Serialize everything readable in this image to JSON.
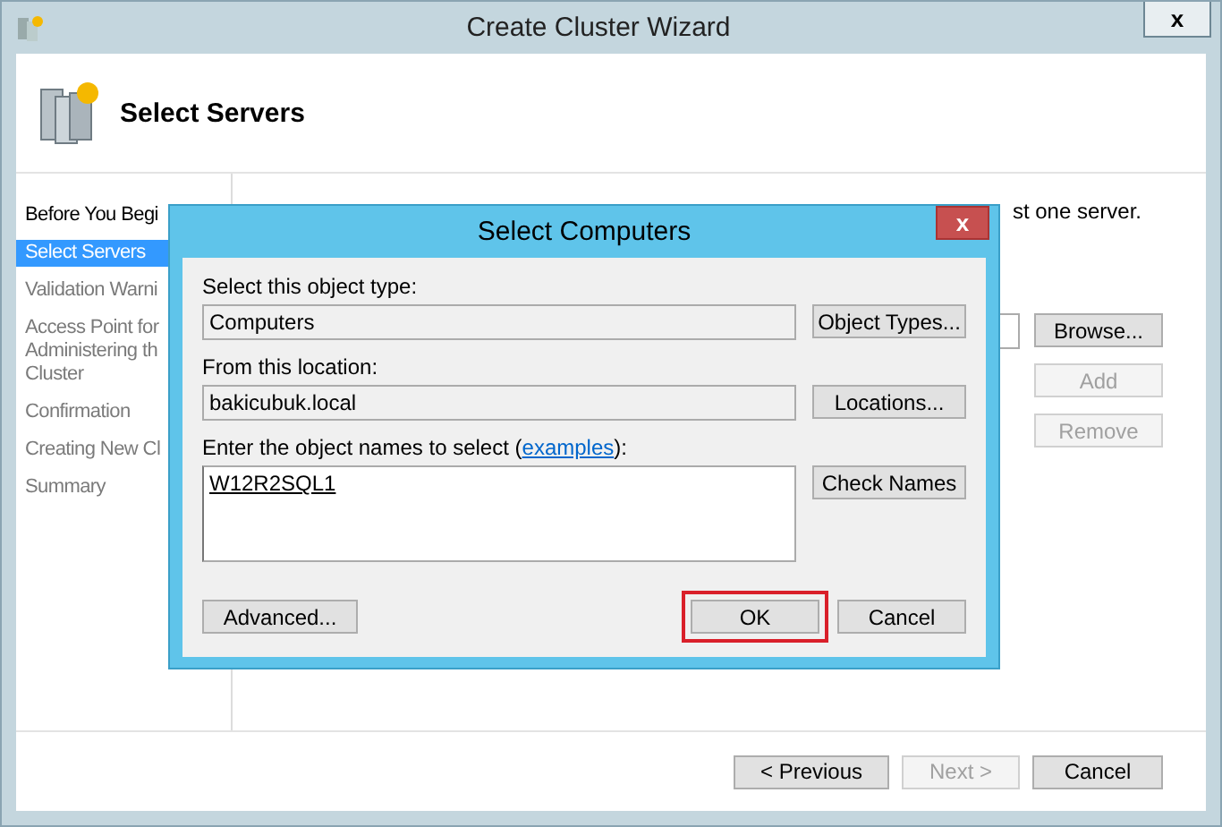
{
  "window": {
    "title": "Create Cluster Wizard",
    "close": "x"
  },
  "header": {
    "title": "Select Servers"
  },
  "steps": [
    {
      "lines": [
        "Before You Begi"
      ],
      "selected": false,
      "disabled": false
    },
    {
      "lines": [
        "Select Servers"
      ],
      "selected": true,
      "disabled": false
    },
    {
      "lines": [
        "Validation Warni"
      ],
      "selected": false,
      "disabled": true
    },
    {
      "lines": [
        "Access Point for",
        "Administering th",
        "Cluster"
      ],
      "selected": false,
      "disabled": true
    },
    {
      "lines": [
        "Confirmation"
      ],
      "selected": false,
      "disabled": true
    },
    {
      "lines": [
        "Creating New Cl"
      ],
      "selected": false,
      "disabled": true
    },
    {
      "lines": [
        "Summary"
      ],
      "selected": false,
      "disabled": true
    }
  ],
  "content": {
    "instruction": "st one server.",
    "side_buttons": [
      {
        "label": "Browse...",
        "disabled": false
      },
      {
        "label": "Add",
        "disabled": true
      },
      {
        "label": "Remove",
        "disabled": true
      }
    ]
  },
  "footer_buttons": [
    {
      "label": "< Previous",
      "disabled": false
    },
    {
      "label": "Next >",
      "disabled": true
    },
    {
      "label": "Cancel",
      "disabled": false
    }
  ],
  "dialog": {
    "title": "Select Computers",
    "close": "x",
    "object_type": {
      "label": "Select this object type:",
      "value": "Computers",
      "button": "Object Types..."
    },
    "location": {
      "label": "From this location:",
      "value": "bakicubuk.local",
      "button": "Locations..."
    },
    "names": {
      "label": "Enter the object names to select (",
      "link": "examples",
      "label_end": "):",
      "value": "W12R2SQL1",
      "button": "Check Names"
    },
    "advanced": "Advanced...",
    "ok": {
      "label": "OK",
      "highlighted": true
    },
    "cancel": "Cancel"
  }
}
